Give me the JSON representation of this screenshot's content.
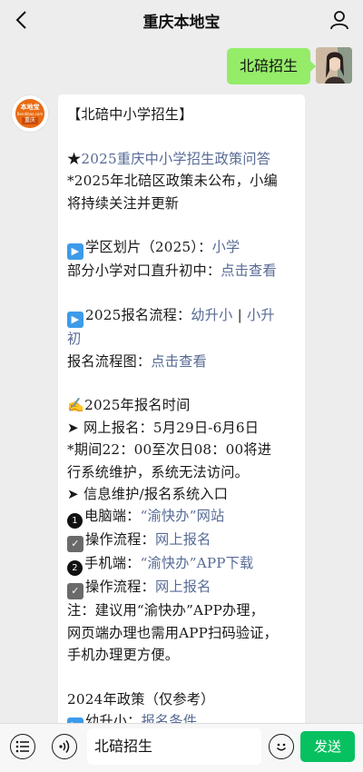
{
  "header": {
    "title": "重庆本地宝"
  },
  "outgoing_message": "北碚招生",
  "bot_avatar": {
    "line1": "本地宝",
    "line2": "Bendibao.com",
    "line3": "重庆"
  },
  "colors": {
    "link": "#576b95",
    "send_button": "#07c160",
    "outgoing_bubble": "#95ec69"
  },
  "message": {
    "lines": [
      {
        "segments": [
          {
            "text": "【北碚中小学招生】"
          }
        ]
      },
      {
        "segments": []
      },
      {
        "segments": [
          {
            "text": "★"
          },
          {
            "text": "2025重庆中小学招生政策问答",
            "link": true
          }
        ]
      },
      {
        "segments": [
          {
            "text": "*2025年北碚区政策未公布，小编"
          }
        ]
      },
      {
        "segments": [
          {
            "text": "将持续关注并更新"
          }
        ]
      },
      {
        "segments": []
      },
      {
        "icon": "play-icon",
        "segments": [
          {
            "text": "学区划片（2025）："
          },
          {
            "text": "小学",
            "link": true
          }
        ]
      },
      {
        "segments": [
          {
            "text": "部分小学对口直升初中："
          },
          {
            "text": "点击查看",
            "link": true
          }
        ]
      },
      {
        "segments": []
      },
      {
        "icon": "play-icon",
        "segments": [
          {
            "text": "2025报名流程："
          },
          {
            "text": "幼升小",
            "link": true
          },
          {
            "text": " | ",
            "sep": true
          },
          {
            "text": "小升",
            "link": true
          }
        ]
      },
      {
        "segments": [
          {
            "text": "初",
            "link": true
          }
        ]
      },
      {
        "segments": [
          {
            "text": "报名流程图："
          },
          {
            "text": "点击查看",
            "link": true
          }
        ]
      },
      {
        "segments": []
      },
      {
        "segments": [
          {
            "text": "✍2025年报名时间"
          }
        ]
      },
      {
        "segments": [
          {
            "text": "➤ 网上报名：5月29日-6月6日"
          }
        ]
      },
      {
        "segments": [
          {
            "text": "*期间22：00至次日08：00将进"
          }
        ]
      },
      {
        "segments": [
          {
            "text": "行系统维护，系统无法访问。"
          }
        ]
      },
      {
        "segments": [
          {
            "text": "➤ 信息维护/报名系统入口"
          }
        ]
      },
      {
        "icon": "number-1-icon",
        "icon_text": "1",
        "segments": [
          {
            "text": "电脑端："
          },
          {
            "text": "“渝快办”网站",
            "link": true
          }
        ]
      },
      {
        "icon": "checkbox-icon",
        "segments": [
          {
            "text": "操作流程："
          },
          {
            "text": "网上报名",
            "link": true
          }
        ]
      },
      {
        "icon": "number-2-icon",
        "icon_text": "2",
        "segments": [
          {
            "text": "手机端："
          },
          {
            "text": "“渝快办”APP下载",
            "link": true
          }
        ]
      },
      {
        "icon": "checkbox-icon",
        "segments": [
          {
            "text": "操作流程："
          },
          {
            "text": "网上报名",
            "link": true
          }
        ]
      },
      {
        "segments": [
          {
            "text": "注：建议用“渝快办”APP办理，"
          }
        ]
      },
      {
        "segments": [
          {
            "text": "网页端办理也需用APP扫码验证，"
          }
        ]
      },
      {
        "segments": [
          {
            "text": "手机办理更方便。"
          }
        ]
      },
      {
        "segments": []
      },
      {
        "segments": [
          {
            "text": "2024年政策（仅参考）"
          }
        ]
      },
      {
        "icon": "play-icon",
        "segments": [
          {
            "text": "幼升小："
          },
          {
            "text": "报名条件",
            "link": true
          }
        ]
      }
    ]
  },
  "input_bar": {
    "value": "北碚招生",
    "send_label": "发送"
  }
}
